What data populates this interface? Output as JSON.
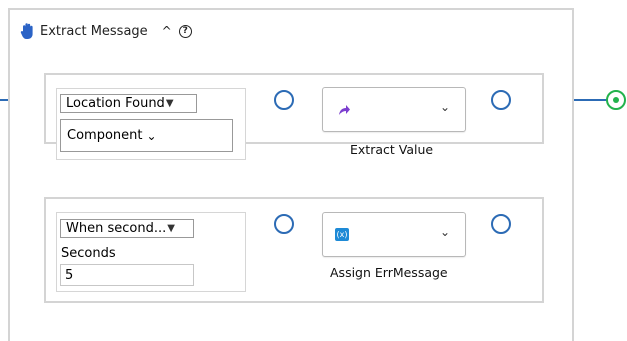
{
  "header": {
    "title": "Extract Message",
    "caret": "^",
    "help": "?"
  },
  "branch1": {
    "condition_select": "Location Found",
    "component_select": "Component",
    "action_label": "Extract Value",
    "action_icon": "purple-arrow-icon"
  },
  "branch2": {
    "condition_select": "When second...",
    "seconds_label": "Seconds",
    "seconds_value": "5",
    "action_label": "Assign ErrMessage",
    "action_icon": "variable-icon"
  },
  "colors": {
    "connector": "#2c6bb5",
    "end_node": "#22b24c",
    "hand_icon": "#2b63c6",
    "purple_arrow": "#7c3fcf",
    "variable_badge": "#1e8ad6"
  }
}
